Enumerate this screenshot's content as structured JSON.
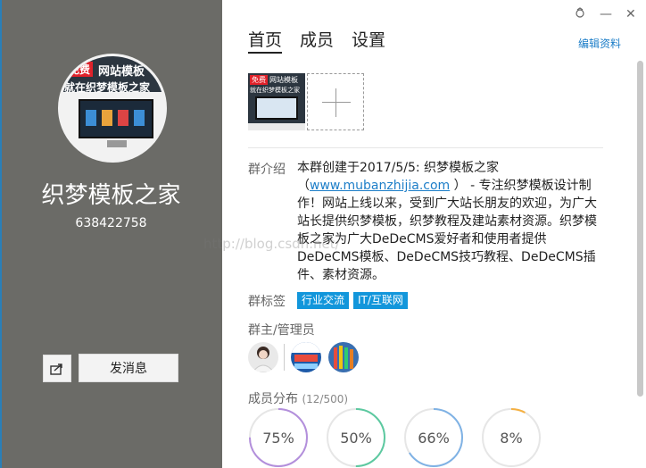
{
  "window": {
    "skin_icon": "skin-icon",
    "minimize": "—",
    "close": "✕"
  },
  "profile": {
    "avatar_badge": "免费",
    "avatar_line1": "网站模板",
    "avatar_line2": "就在织梦模板之家",
    "name": "织梦模板之家",
    "id": "638422758",
    "send_message": "发消息"
  },
  "tabs": [
    {
      "label": "首页",
      "active": true
    },
    {
      "label": "成员",
      "active": false
    },
    {
      "label": "设置",
      "active": false
    }
  ],
  "edit_profile": "编辑资料",
  "intro": {
    "label": "群介绍",
    "line1": "本群创建于2017/5/5:  织梦模板之家",
    "link_open": "（",
    "link": "www.mubanzhijia.com",
    "link_close": " ）",
    "rest": "- 专注织梦模板设计制作！网站上线以来，受到广大站长朋友的欢迎，为广大站长提供织梦模板，织梦教程及建站素材资源。织梦模板之家为广大DeDeCMS爱好者和使用者提供DeDeCMS模板、DeDeCMS技巧教程、DeDeCMS插件、素材资源。"
  },
  "tags": {
    "label": "群标签",
    "items": [
      "行业交流",
      "IT/互联网"
    ],
    "color": "#1296db"
  },
  "admins": {
    "label": "群主/管理员"
  },
  "distribution": {
    "label": "成员分布",
    "count": "(12/500)",
    "rings": [
      {
        "value": 75,
        "label": "75%",
        "color": "#b38fdc"
      },
      {
        "value": 50,
        "label": "50%",
        "color": "#5cc9a0"
      },
      {
        "value": 66,
        "label": "66%",
        "color": "#7fb2e5"
      },
      {
        "value": 8,
        "label": "8%",
        "color": "#f5b041"
      }
    ]
  },
  "watermark": "http://blog.csdn.net/"
}
